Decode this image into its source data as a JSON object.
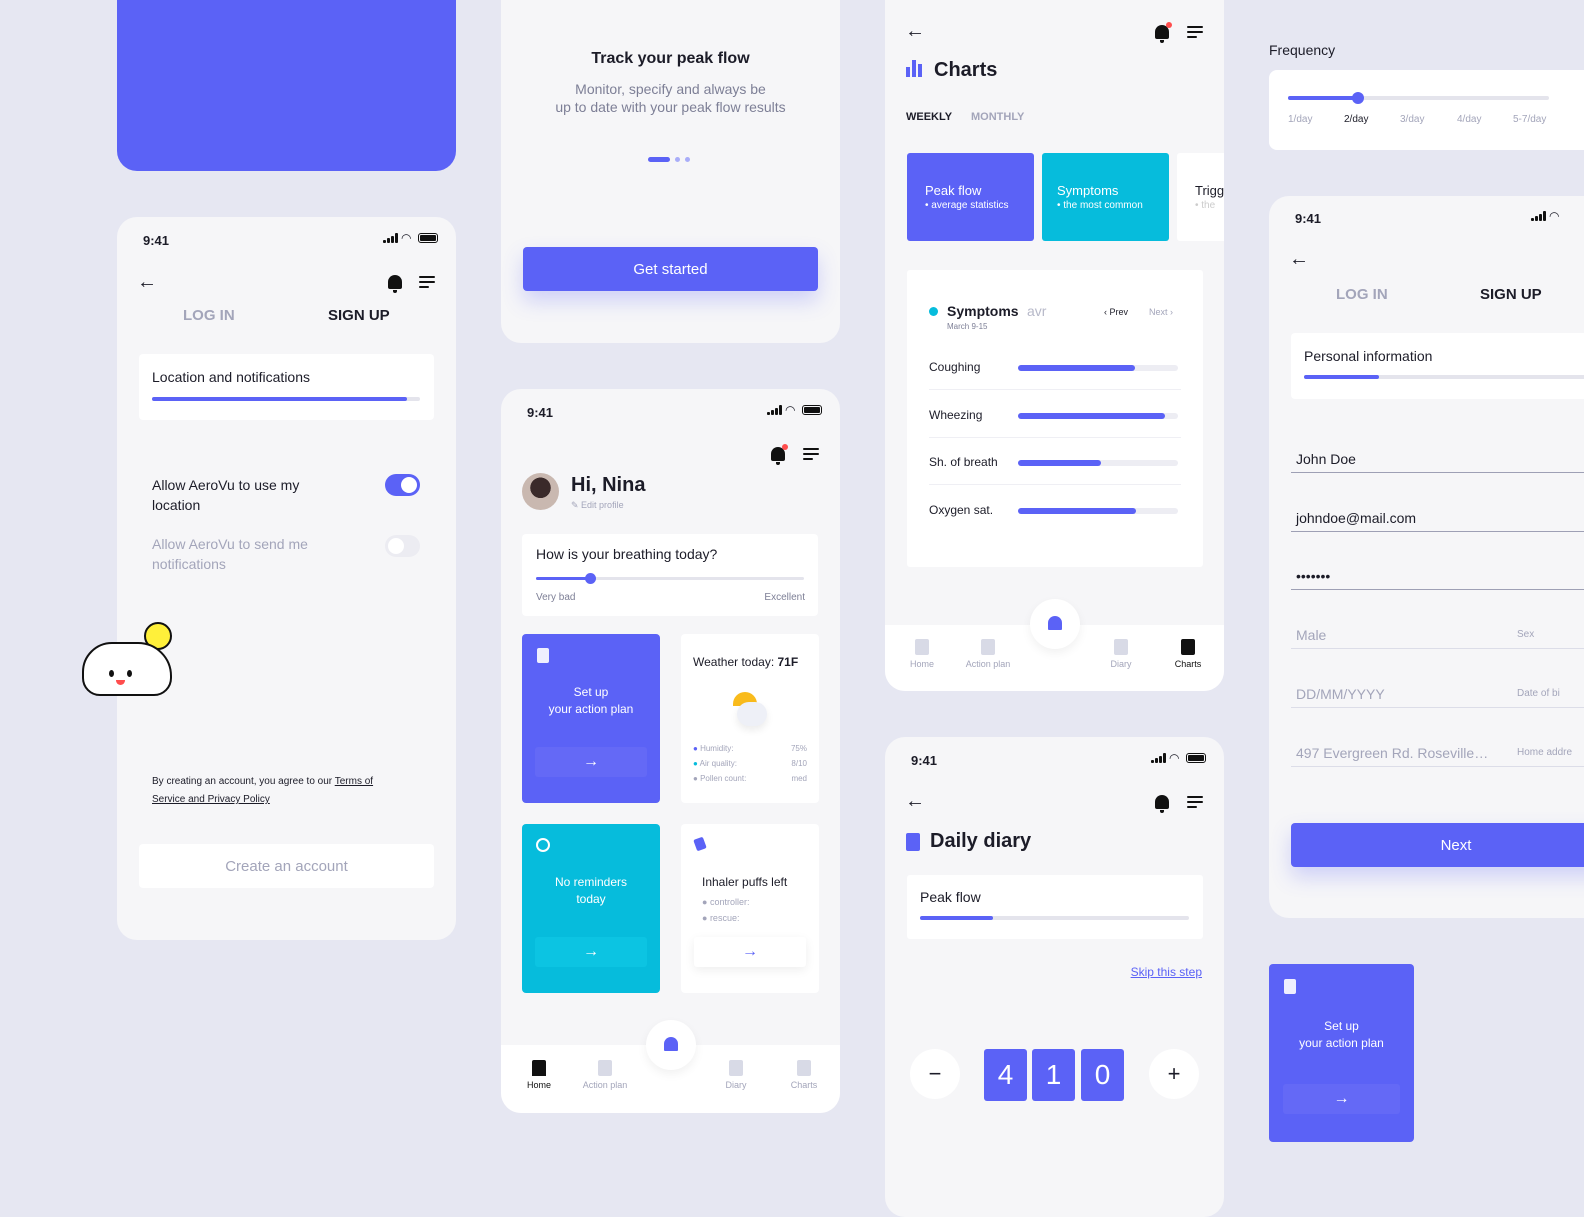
{
  "colors": {
    "primary": "#5b62f6",
    "cyan": "#06bcdc",
    "bg": "#e6e7f2"
  },
  "status_time": "9:41",
  "signup1": {
    "tabs": [
      "LOG IN",
      "SIGN UP"
    ],
    "section": "Location and notifications",
    "progress": 0.95,
    "toggles": [
      {
        "label1": "Allow AeroVu to use my",
        "label2": "location",
        "on": true
      },
      {
        "label1": "Allow AeroVu to send me",
        "label2": "notifications",
        "on": false
      }
    ],
    "terms1": "By creating an account, you agree to our ",
    "terms_link1": "Terms of",
    "terms_link2": "Service and Privacy Policy",
    "create_button": "Create an account"
  },
  "onboarding": {
    "title": "Track your peak flow",
    "line1": "Monitor, specify and always be",
    "line2": "up to date with your peak flow results",
    "cta": "Get started",
    "page": 1,
    "pages": 3
  },
  "home": {
    "greeting": "Hi, Nina",
    "edit": "Edit profile",
    "question": "How is your breathing today?",
    "slider_value": 0.2,
    "low": "Very bad",
    "high": "Excellent",
    "action_plan": [
      "Set up",
      "your action plan"
    ],
    "weather_label": "Weather today: ",
    "weather_temp": "71F",
    "weather_rows": [
      {
        "label": "Humidity:",
        "value": "75%"
      },
      {
        "label": "Air quality:",
        "value": "8/10"
      },
      {
        "label": "Pollen count:",
        "value": "med"
      }
    ],
    "reminders": [
      "No reminders",
      "today"
    ],
    "inhaler_title": "Inhaler puffs left",
    "inhaler_rows": [
      "controller:",
      "rescue:"
    ],
    "nav": [
      "Home",
      "Action plan",
      "Diary",
      "Charts"
    ]
  },
  "charts": {
    "title": "Charts",
    "tabs": [
      "WEEKLY",
      "MONTHLY"
    ],
    "tiles": [
      {
        "title": "Peak flow",
        "sub": "average statistics"
      },
      {
        "title": "Symptoms",
        "sub": "the most common"
      },
      {
        "title": "Trigg",
        "sub": "the"
      }
    ],
    "panel_title": "Symptoms",
    "panel_avr": "avr",
    "panel_date": "March 9-15",
    "prev": "Prev",
    "next": "Next",
    "rows": [
      {
        "label": "Coughing",
        "value": 0.73
      },
      {
        "label": "Wheezing",
        "value": 0.92
      },
      {
        "label": "Sh. of breath",
        "value": 0.52
      },
      {
        "label": "Oxygen sat.",
        "value": 0.74
      }
    ],
    "nav": [
      "Home",
      "Action plan",
      "Diary",
      "Charts"
    ]
  },
  "diary": {
    "title": "Daily diary",
    "section": "Peak flow",
    "progress": 0.27,
    "skip": "Skip this step",
    "digits": [
      "4",
      "1",
      "0"
    ],
    "minus": "−",
    "plus": "+"
  },
  "frequency": {
    "label": "Frequency",
    "options": [
      "1/day",
      "2/day",
      "3/day",
      "4/day",
      "5-7/day"
    ],
    "selected": 1
  },
  "signup2": {
    "tabs": [
      "LOG IN",
      "SIGN UP"
    ],
    "section": "Personal information",
    "progress": 0.3,
    "fields": [
      {
        "value": "John Doe",
        "label": ""
      },
      {
        "value": "johndoe@mail.com",
        "label": ""
      },
      {
        "value": "•••••••",
        "label": ""
      },
      {
        "value": "Male",
        "label": "Sex"
      },
      {
        "value": "DD/MM/YYYY",
        "label": "Date of bi"
      },
      {
        "value": "497 Evergreen Rd. Roseville…",
        "label": "Home addre"
      }
    ],
    "next": "Next"
  },
  "mini_action": [
    "Set up",
    "your action plan"
  ]
}
